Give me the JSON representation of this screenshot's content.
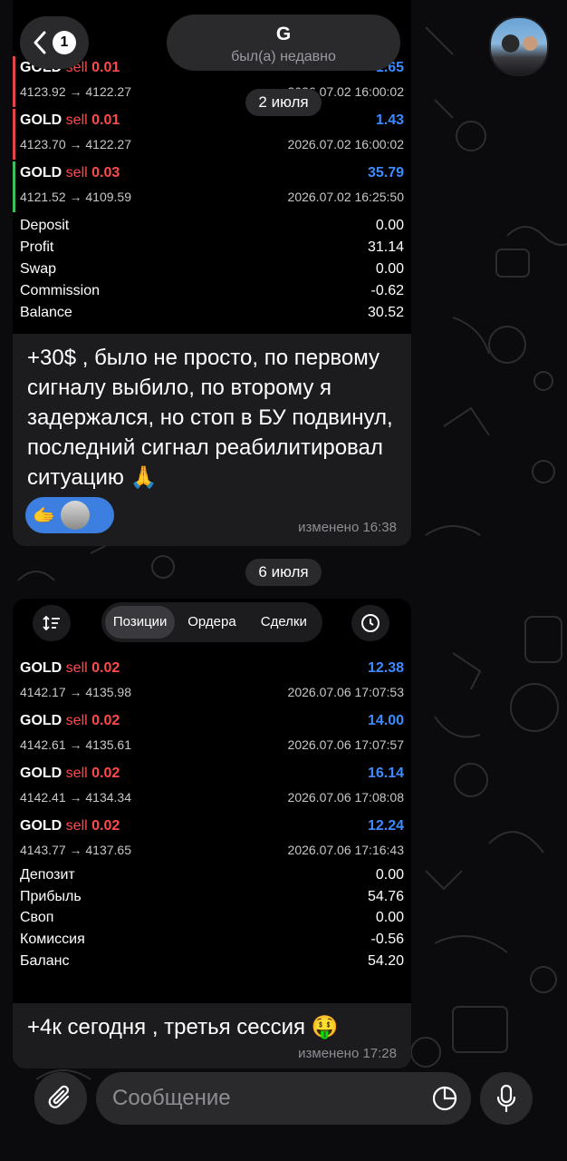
{
  "header": {
    "unread_count": "1",
    "chat_name": "G",
    "status": "был(а) недавно"
  },
  "dates": [
    "2 июля",
    "6 июля"
  ],
  "message1": {
    "trades": [
      {
        "symbol": "GOLD",
        "side": "sell",
        "volume": "0.01",
        "profit": "1.65",
        "prices": "4123.92 → 4122.27",
        "time": "2026.07.02 16:00:02"
      },
      {
        "symbol": "GOLD",
        "side": "sell",
        "volume": "0.01",
        "profit": "1.43",
        "prices": "4123.70 → 4122.27",
        "time": "2026.07.02 16:00:02"
      },
      {
        "symbol": "GOLD",
        "side": "sell",
        "volume": "0.03",
        "profit": "35.79",
        "prices": "4121.52 → 4109.59",
        "time": "2026.07.02 16:25:50"
      }
    ],
    "summary": [
      {
        "label": "Deposit",
        "value": "0.00"
      },
      {
        "label": "Profit",
        "value": "31.14"
      },
      {
        "label": "Swap",
        "value": "0.00"
      },
      {
        "label": "Commission",
        "value": "-0.62"
      },
      {
        "label": "Balance",
        "value": "30.52"
      }
    ],
    "text": "+30$ , было не просто, по первому сигналу выбило, по второму я задержался, но стоп в БУ подвинул, последний сигнал реабилитировал ситуацию 🙏",
    "reaction_emoji": "🫱",
    "edited": "изменено 16:38"
  },
  "message2": {
    "tabs": [
      "Позиции",
      "Ордера",
      "Сделки"
    ],
    "active_tab": "Позиции",
    "trades": [
      {
        "symbol": "GOLD",
        "side": "sell",
        "volume": "0.02",
        "profit": "12.38",
        "prices": "4142.17 → 4135.98",
        "time": "2026.07.06 17:07:53"
      },
      {
        "symbol": "GOLD",
        "side": "sell",
        "volume": "0.02",
        "profit": "14.00",
        "prices": "4142.61 → 4135.61",
        "time": "2026.07.06 17:07:57"
      },
      {
        "symbol": "GOLD",
        "side": "sell",
        "volume": "0.02",
        "profit": "16.14",
        "prices": "4142.41 → 4134.34",
        "time": "2026.07.06 17:08:08"
      },
      {
        "symbol": "GOLD",
        "side": "sell",
        "volume": "0.02",
        "profit": "12.24",
        "prices": "4143.77 → 4137.65",
        "time": "2026.07.06 17:16:43"
      }
    ],
    "summary": [
      {
        "label": "Депозит",
        "value": "0.00"
      },
      {
        "label": "Прибыль",
        "value": "54.76"
      },
      {
        "label": "Своп",
        "value": "0.00"
      },
      {
        "label": "Комиссия",
        "value": "-0.56"
      },
      {
        "label": "Баланс",
        "value": "54.20"
      }
    ],
    "text": "+4к сегодня , третья сессия 🤑",
    "edited": "изменено 17:28"
  },
  "composer": {
    "placeholder": "Сообщение"
  },
  "colors": {
    "sell": "#ff4a4a",
    "profit": "#3d8bff",
    "reaction": "#3d7fe0",
    "loss_bar": "#e04848",
    "win_bar": "#3fbf5a"
  }
}
